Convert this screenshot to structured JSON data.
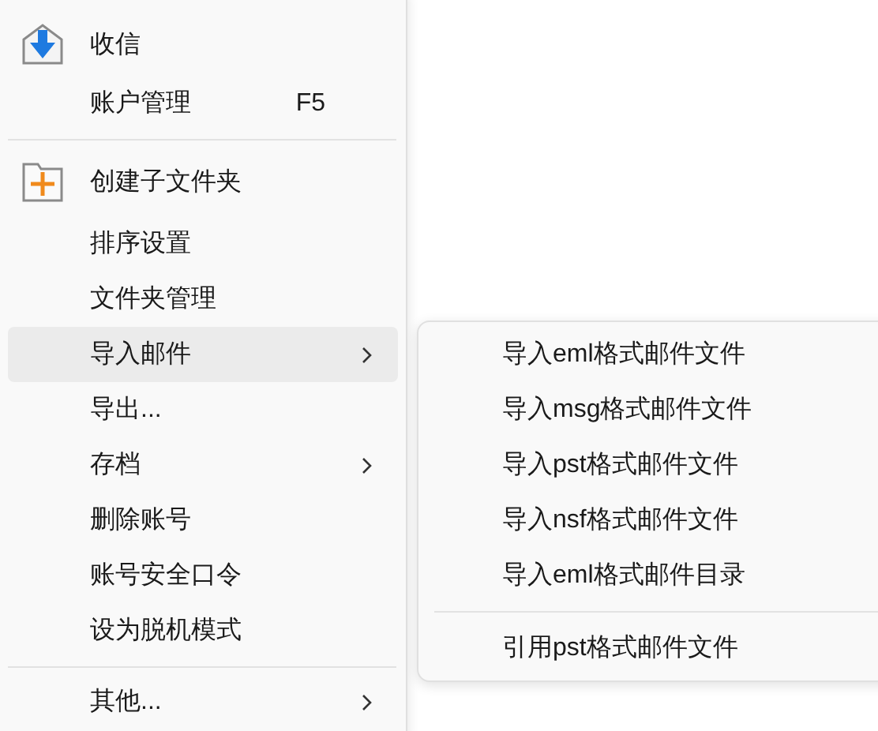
{
  "menu": {
    "items": [
      {
        "kind": "item",
        "label": "收信",
        "selected": false
      },
      {
        "kind": "item",
        "label": "账户管理",
        "shortcut": "F5",
        "selected": false
      },
      {
        "kind": "separator"
      },
      {
        "kind": "item",
        "label": "创建子文件夹",
        "selected": false
      },
      {
        "kind": "item",
        "label": "排序设置",
        "selected": false
      },
      {
        "kind": "item",
        "label": "文件夹管理",
        "selected": false
      },
      {
        "kind": "item",
        "label": "导入邮件",
        "selected": true,
        "has_submenu": true
      },
      {
        "kind": "item",
        "label": "导出...",
        "selected": false
      },
      {
        "kind": "item",
        "label": "存档",
        "selected": false,
        "has_submenu": true
      },
      {
        "kind": "item",
        "label": "删除账号",
        "selected": false
      },
      {
        "kind": "item",
        "label": "账号安全口令",
        "selected": false
      },
      {
        "kind": "item",
        "label": "设为脱机模式",
        "selected": false
      },
      {
        "kind": "separator"
      },
      {
        "kind": "item",
        "label": "其他...",
        "selected": false,
        "has_submenu": true
      }
    ]
  },
  "submenu": {
    "items": [
      {
        "kind": "item",
        "label": "导入eml格式邮件文件"
      },
      {
        "kind": "item",
        "label": "导入msg格式邮件文件"
      },
      {
        "kind": "item",
        "label": "导入pst格式邮件文件"
      },
      {
        "kind": "item",
        "label": "导入nsf格式邮件文件"
      },
      {
        "kind": "item",
        "label": "导入eml格式邮件目录"
      },
      {
        "kind": "separator"
      },
      {
        "kind": "item",
        "label": "引用pst格式邮件文件"
      }
    ]
  }
}
